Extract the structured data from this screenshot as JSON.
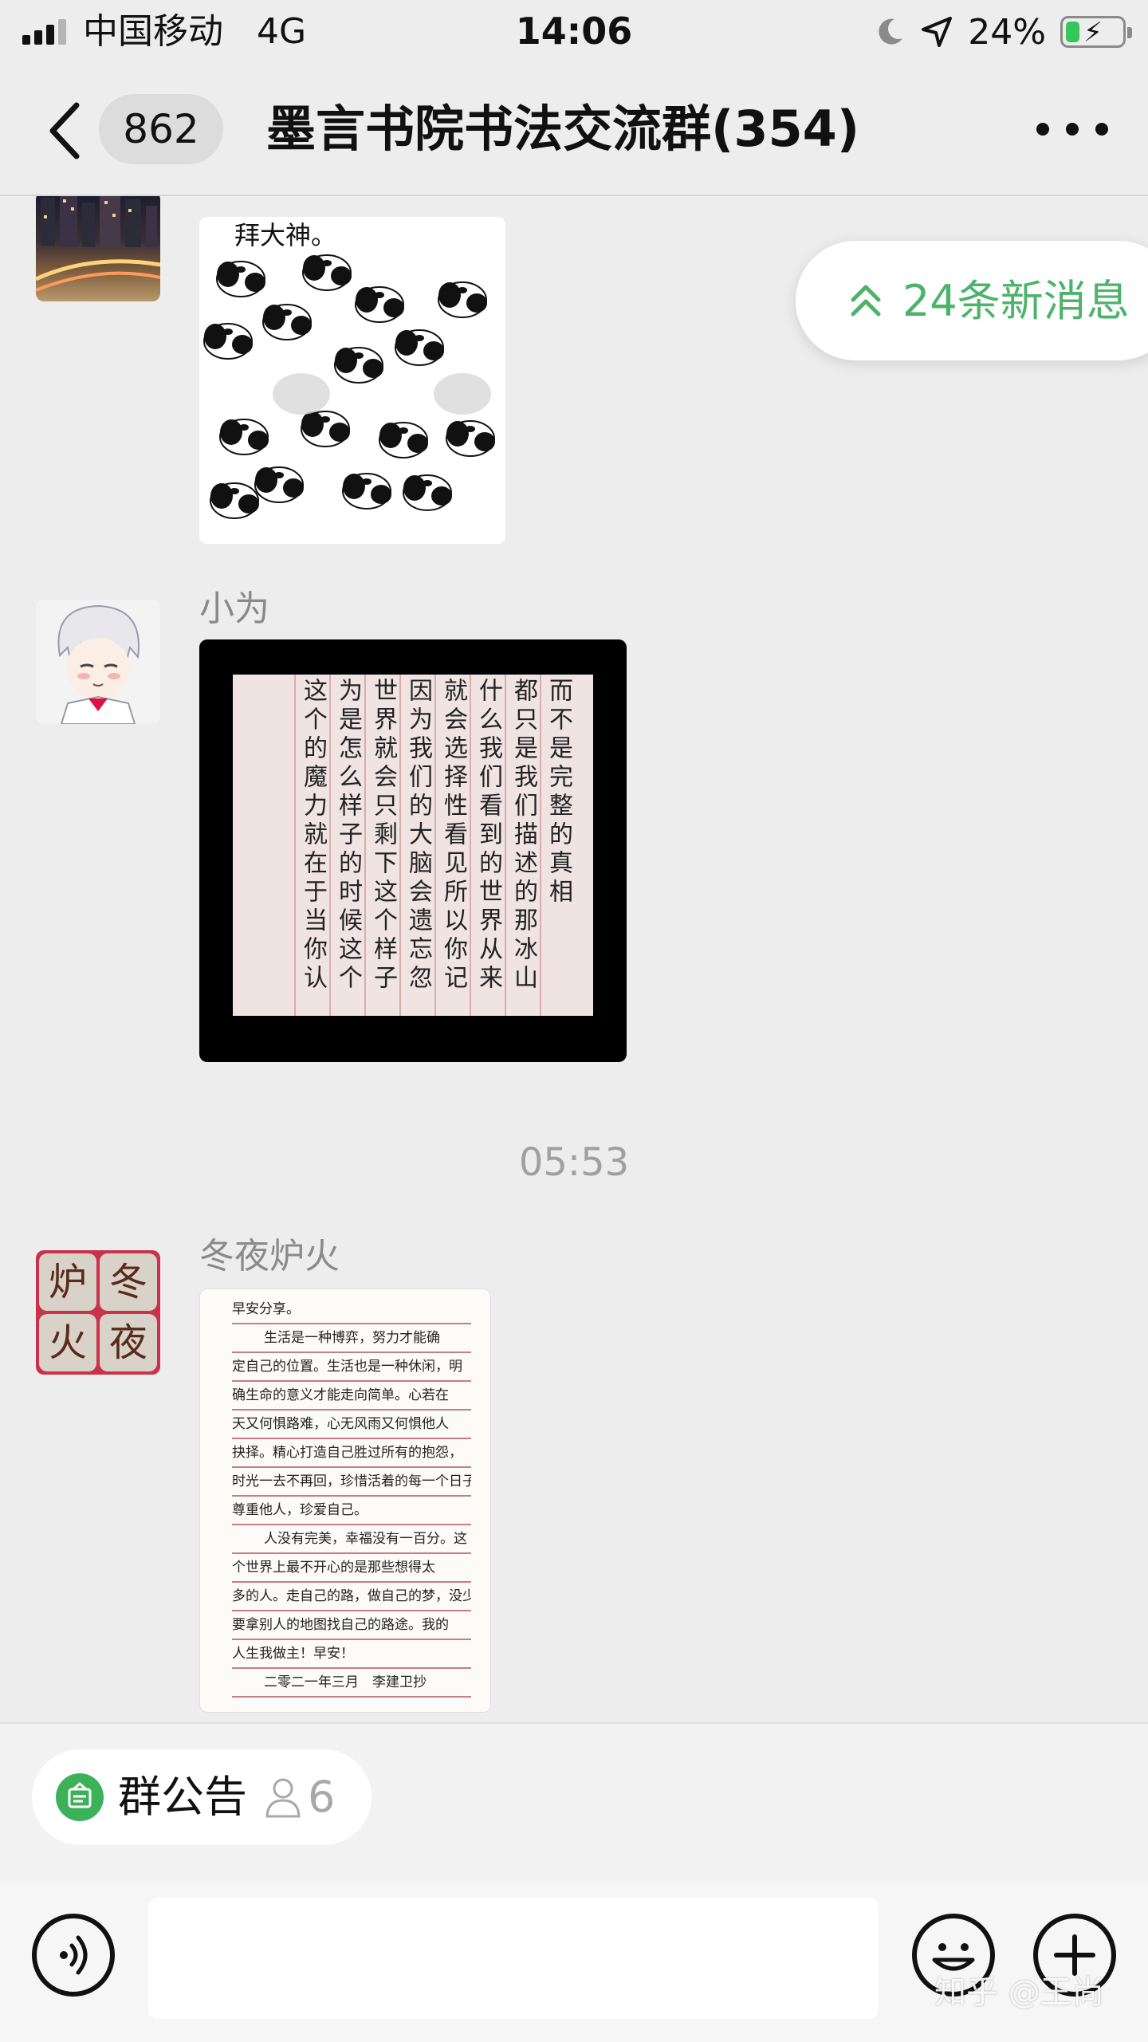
{
  "status_bar": {
    "carrier": "中国移动",
    "network": "4G",
    "time": "14:06",
    "battery_percent": "24%",
    "battery_level": 0.24,
    "icons": [
      "signal-icon",
      "moon-icon",
      "location-arrow-icon",
      "battery-charging-icon"
    ]
  },
  "nav": {
    "unread_count": "862",
    "title": "墨言书院书法交流群(354)",
    "icons": [
      "back-chevron-icon",
      "more-dots-icon"
    ]
  },
  "new_messages": {
    "label": "24条新消息",
    "icon": "double-chevron-up-icon",
    "color": "#4bb36a"
  },
  "messages": [
    {
      "type": "image",
      "sender": "",
      "avatar": "city-night-avatar",
      "image": "panda-bow-sticker",
      "image_caption": "拜大神。"
    },
    {
      "type": "image",
      "sender": "小为",
      "avatar": "anime-character-avatar",
      "image": "calligraphy-photo-black-frame",
      "calligraphy_text": [
        "而不是完整的真相",
        "都只是我们描述的那冰山一角",
        "什么我们看到的世界从来",
        "就会选择性看见所以你记住",
        "因为我们的大脑会遗忘忽",
        "世界就会只剩下这个样子",
        "为是怎么样子的时候这个",
        "这个的魔力就在于当你认"
      ]
    },
    {
      "type": "timestamp",
      "text": "05:53"
    },
    {
      "type": "image",
      "sender": "冬夜炉火",
      "avatar_chars": [
        "炉",
        "冬",
        "火",
        "夜"
      ],
      "image": "handwritten-letter-paper",
      "letter_lines": [
        "早安分享。",
        "生活是一种博弈，努力才能确",
        "定自己的位置。生活也是一种休闲，明",
        "确生命的意义才能走向简单。心若在",
        "天又何惧路难，心无风雨又何惧他人",
        "抉择。精心打造自己胜过所有的抱怨，",
        "时光一去不再回，珍惜活着的每一个日子，",
        "尊重他人，珍爱自己。",
        "人没有完美，幸福没有一百分。这",
        "个世界上最不开心的是那些想得太",
        "多的人。走自己的路，做自己的梦，没少",
        "要拿别人的地图找自己的路途。我的",
        "人生我做主！早安！",
        "二零二一年三月　李建卫抄"
      ]
    }
  ],
  "announcement": {
    "label": "群公告",
    "count": "6",
    "icon": "announcement-icon",
    "person_icon": "person-outline-icon"
  },
  "input_bar": {
    "placeholder": "",
    "icons": [
      "voice-icon",
      "emoji-icon",
      "plus-icon"
    ]
  },
  "watermark": "知乎 @王尚"
}
